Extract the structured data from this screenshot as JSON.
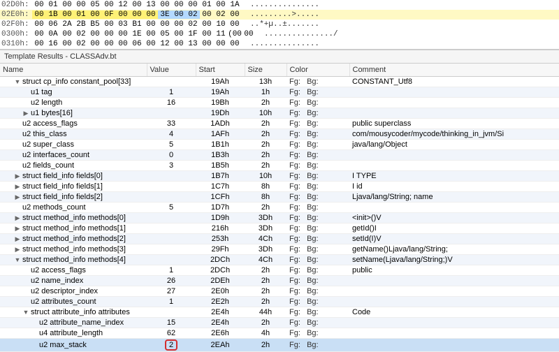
{
  "hex": {
    "rows": [
      {
        "addr": "02D0h:",
        "bytes": [
          "00",
          "01",
          "00",
          "00",
          "05",
          "00",
          "12",
          "00",
          "13",
          "00",
          "00",
          "00",
          "01",
          "00",
          "1A"
        ],
        "hl": [],
        "ascii": "..............."
      },
      {
        "addr": "02E0h:",
        "bytes": [
          "00",
          "1B",
          "00",
          "01",
          "00",
          "0F",
          "00",
          "00",
          "00",
          "3E",
          "00",
          "02",
          "00",
          "02",
          "00"
        ],
        "hl": [
          0,
          1,
          2,
          3,
          4,
          5,
          6,
          7,
          8,
          9,
          10,
          11
        ],
        "sel": [
          10,
          11
        ],
        "blue": [
          9
        ],
        "ascii": ".........>....."
      },
      {
        "addr": "02F0h:",
        "bytes": [
          "00",
          "06",
          "2A",
          "2B",
          "B5",
          "00",
          "03",
          "B1",
          "00",
          "00",
          "00",
          "02",
          "00",
          "10",
          "00"
        ],
        "hl": [],
        "ascii": "..*+µ..±......."
      },
      {
        "addr": "0300h:",
        "bytes": [
          "00",
          "0A",
          "00",
          "02",
          "00",
          "00",
          "00",
          "1E",
          "00",
          "05",
          "00",
          "1F",
          "00",
          "11",
          "(00",
          "00"
        ],
        "hl": [],
        "ascii": ".............../"
      },
      {
        "addr": "0310h:",
        "bytes": [
          "00",
          "16",
          "00",
          "02",
          "00",
          "00",
          "00",
          "06",
          "00",
          "12",
          "00",
          "13",
          "00",
          "00",
          "00"
        ],
        "hl": [],
        "ascii": "..............."
      }
    ]
  },
  "panel_title": "Template Results - CLASSAdv.bt",
  "columns": {
    "name": "Name",
    "value": "Value",
    "start": "Start",
    "size": "Size",
    "color": "Color",
    "comment": "Comment"
  },
  "fg": "Fg:",
  "bg": "Bg:",
  "rows": [
    {
      "toggle": "▼",
      "indent": 1,
      "name": "struct cp_info constant_pool[33]",
      "value": "",
      "start": "19Ah",
      "size": "13h",
      "comment": "CONSTANT_Utf8",
      "alt": false
    },
    {
      "toggle": "",
      "indent": 2,
      "name": "u1 tag",
      "value": "1",
      "start": "19Ah",
      "size": "1h",
      "comment": "",
      "alt": true
    },
    {
      "toggle": "",
      "indent": 2,
      "name": "u2 length",
      "value": "16",
      "start": "19Bh",
      "size": "2h",
      "comment": "",
      "alt": false
    },
    {
      "toggle": "▶",
      "indent": 2,
      "name": "u1 bytes[16]",
      "value": "",
      "start": "19Dh",
      "size": "10h",
      "comment": "",
      "alt": true
    },
    {
      "toggle": "",
      "indent": 1,
      "name": "u2 access_flags",
      "value": "33",
      "start": "1ADh",
      "size": "2h",
      "comment": "public superclass",
      "alt": false
    },
    {
      "toggle": "",
      "indent": 1,
      "name": "u2 this_class",
      "value": "4",
      "start": "1AFh",
      "size": "2h",
      "comment": "com/mousycoder/mycode/thinking_in_jvm/Si",
      "alt": true
    },
    {
      "toggle": "",
      "indent": 1,
      "name": "u2 super_class",
      "value": "5",
      "start": "1B1h",
      "size": "2h",
      "comment": "java/lang/Object",
      "alt": false
    },
    {
      "toggle": "",
      "indent": 1,
      "name": "u2 interfaces_count",
      "value": "0",
      "start": "1B3h",
      "size": "2h",
      "comment": "",
      "alt": true
    },
    {
      "toggle": "",
      "indent": 1,
      "name": "u2 fields_count",
      "value": "3",
      "start": "1B5h",
      "size": "2h",
      "comment": "",
      "alt": false
    },
    {
      "toggle": "▶",
      "indent": 1,
      "name": "struct field_info fields[0]",
      "value": "",
      "start": "1B7h",
      "size": "10h",
      "comment": "I TYPE",
      "alt": true
    },
    {
      "toggle": "▶",
      "indent": 1,
      "name": "struct field_info fields[1]",
      "value": "",
      "start": "1C7h",
      "size": "8h",
      "comment": "I id",
      "alt": false
    },
    {
      "toggle": "▶",
      "indent": 1,
      "name": "struct field_info fields[2]",
      "value": "",
      "start": "1CFh",
      "size": "8h",
      "comment": "Ljava/lang/String; name",
      "alt": true
    },
    {
      "toggle": "",
      "indent": 1,
      "name": "u2 methods_count",
      "value": "5",
      "start": "1D7h",
      "size": "2h",
      "comment": "",
      "alt": false
    },
    {
      "toggle": "▶",
      "indent": 1,
      "name": "struct method_info methods[0]",
      "value": "",
      "start": "1D9h",
      "size": "3Dh",
      "comment": "<init>()V",
      "alt": true
    },
    {
      "toggle": "▶",
      "indent": 1,
      "name": "struct method_info methods[1]",
      "value": "",
      "start": "216h",
      "size": "3Dh",
      "comment": "getId()I",
      "alt": false
    },
    {
      "toggle": "▶",
      "indent": 1,
      "name": "struct method_info methods[2]",
      "value": "",
      "start": "253h",
      "size": "4Ch",
      "comment": "setId(I)V",
      "alt": true
    },
    {
      "toggle": "▶",
      "indent": 1,
      "name": "struct method_info methods[3]",
      "value": "",
      "start": "29Fh",
      "size": "3Dh",
      "comment": "getName()Ljava/lang/String;",
      "alt": false
    },
    {
      "toggle": "▼",
      "indent": 1,
      "name": "struct method_info methods[4]",
      "value": "",
      "start": "2DCh",
      "size": "4Ch",
      "comment": "setName(Ljava/lang/String;)V",
      "alt": true
    },
    {
      "toggle": "",
      "indent": 2,
      "name": "u2 access_flags",
      "value": "1",
      "start": "2DCh",
      "size": "2h",
      "comment": "public",
      "alt": false
    },
    {
      "toggle": "",
      "indent": 2,
      "name": "u2 name_index",
      "value": "26",
      "start": "2DEh",
      "size": "2h",
      "comment": "",
      "alt": true
    },
    {
      "toggle": "",
      "indent": 2,
      "name": "u2 descriptor_index",
      "value": "27",
      "start": "2E0h",
      "size": "2h",
      "comment": "",
      "alt": false
    },
    {
      "toggle": "",
      "indent": 2,
      "name": "u2 attributes_count",
      "value": "1",
      "start": "2E2h",
      "size": "2h",
      "comment": "",
      "alt": true
    },
    {
      "toggle": "▼",
      "indent": 2,
      "name": "struct attribute_info attributes",
      "value": "",
      "start": "2E4h",
      "size": "44h",
      "comment": "Code",
      "alt": false
    },
    {
      "toggle": "",
      "indent": 3,
      "name": "u2 attribute_name_index",
      "value": "15",
      "start": "2E4h",
      "size": "2h",
      "comment": "",
      "alt": true
    },
    {
      "toggle": "",
      "indent": 3,
      "name": "u4 attribute_length",
      "value": "62",
      "start": "2E6h",
      "size": "4h",
      "comment": "",
      "alt": false
    },
    {
      "toggle": "",
      "indent": 3,
      "name": "u2 max_stack",
      "value": "2",
      "start": "2EAh",
      "size": "2h",
      "comment": "",
      "sel": true,
      "circled": true
    }
  ]
}
